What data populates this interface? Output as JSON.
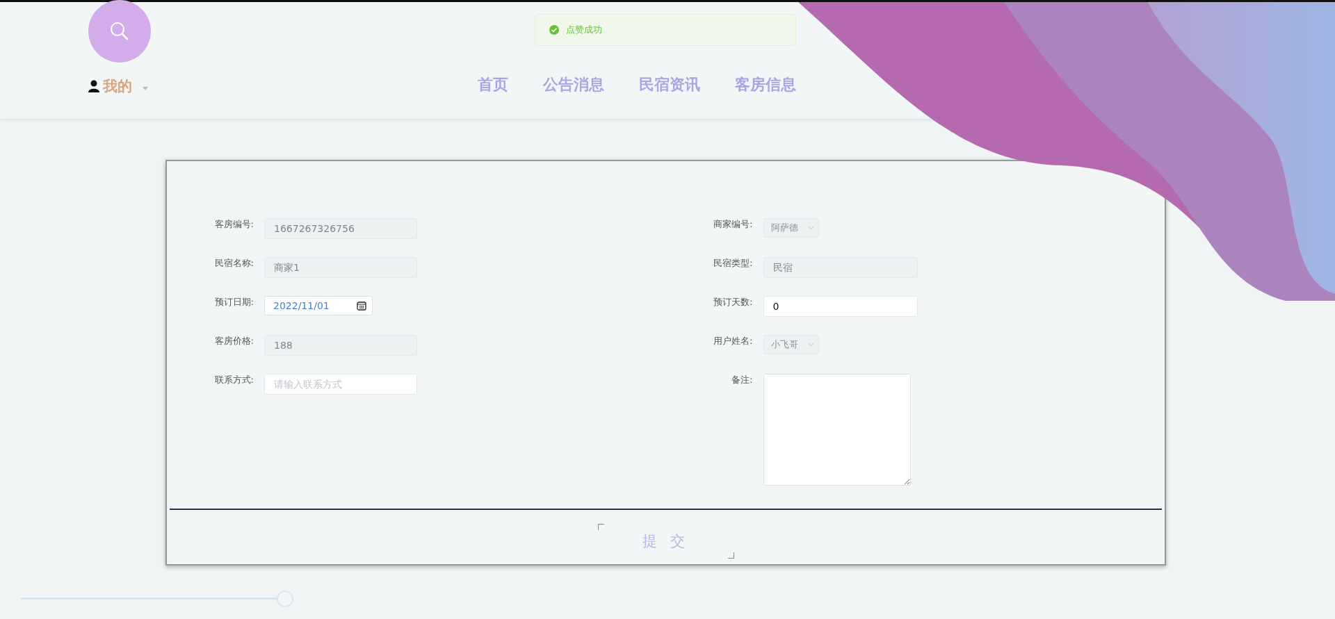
{
  "header": {
    "user_menu": {
      "label": "我的"
    },
    "nav": [
      {
        "label": "首页"
      },
      {
        "label": "公告消息"
      },
      {
        "label": "民宿资讯"
      },
      {
        "label": "客房信息"
      }
    ]
  },
  "toast": {
    "message": "点赞成功"
  },
  "form": {
    "left_fields": [
      {
        "label": "客房编号:",
        "kind": "readonly",
        "value": "1667267326756"
      },
      {
        "label": "民宿名称:",
        "kind": "readonly",
        "value": "商家1"
      },
      {
        "label": "预订日期:",
        "kind": "date",
        "value": "2022/11/01"
      },
      {
        "label": "客房价格:",
        "kind": "readonly",
        "value": "188"
      },
      {
        "label": "联系方式:",
        "kind": "text",
        "placeholder": "请输入联系方式"
      }
    ],
    "right_fields": [
      {
        "label": "商家编号:",
        "kind": "select",
        "value": "阿萨德"
      },
      {
        "label": "民宿类型:",
        "kind": "readonly",
        "value": "民宿"
      },
      {
        "label": "预订天数:",
        "kind": "number",
        "value": "0"
      },
      {
        "label": "用户姓名:",
        "kind": "select",
        "value": "小飞哥"
      },
      {
        "label": "备注:",
        "kind": "textarea"
      }
    ],
    "submit": {
      "label": "提 交"
    }
  },
  "slider": {
    "level": 1
  }
}
